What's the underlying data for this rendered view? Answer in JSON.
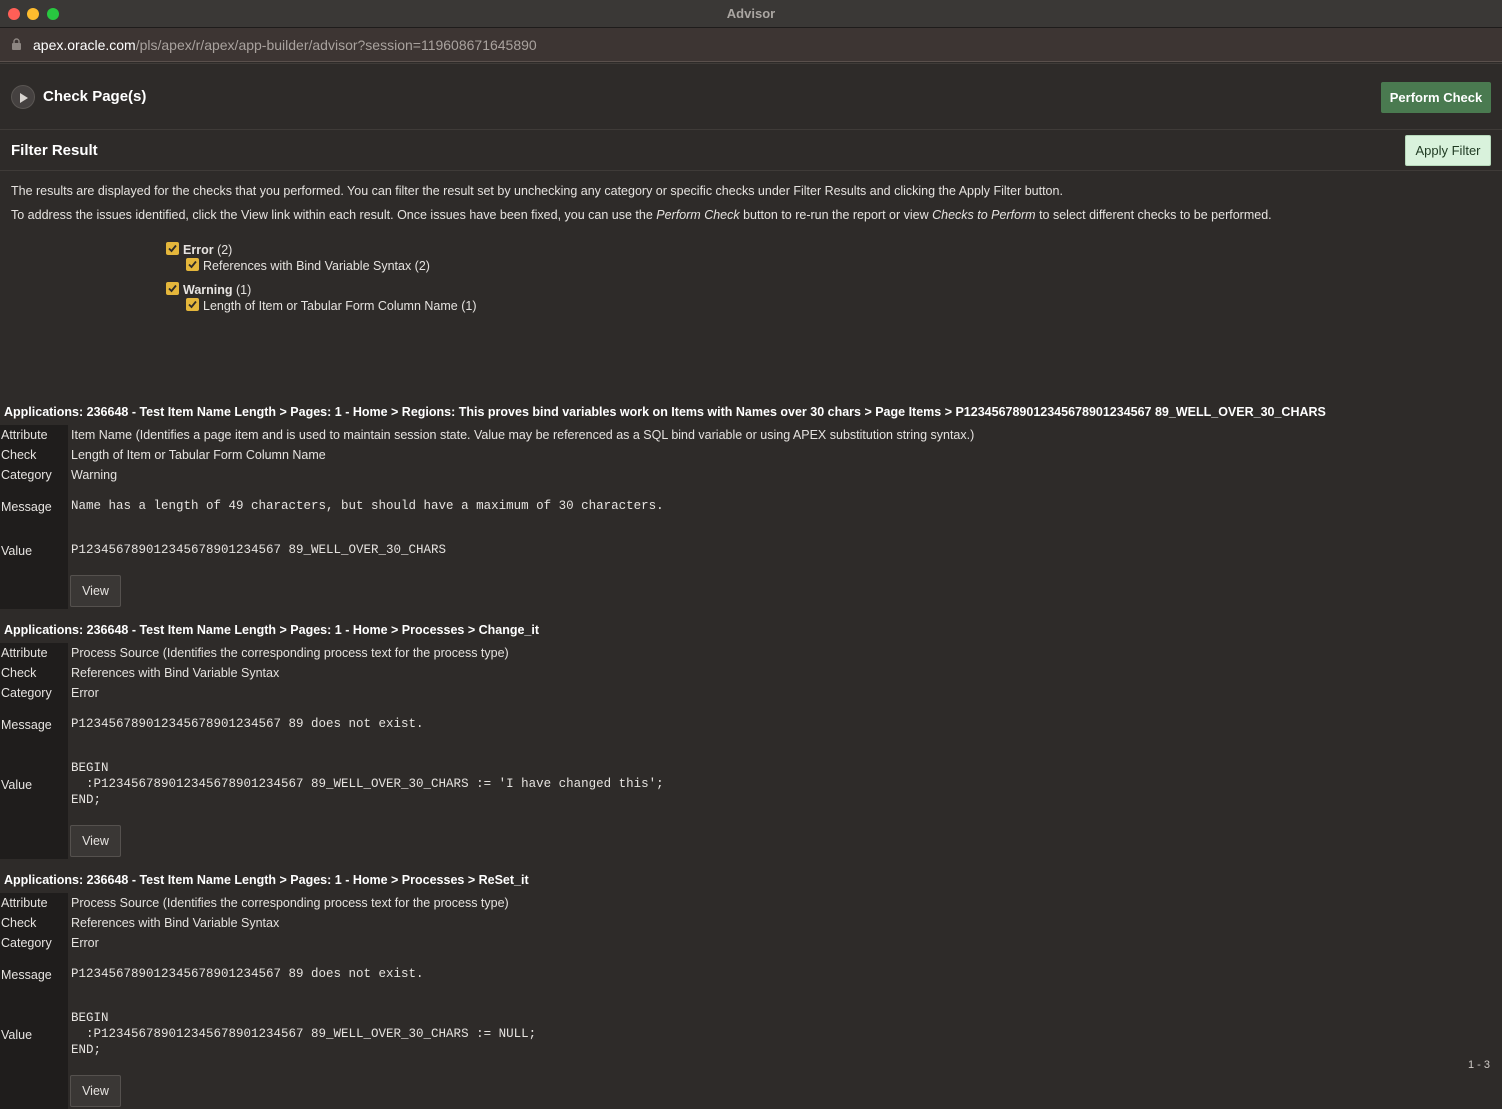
{
  "window": {
    "title": "Advisor"
  },
  "browser": {
    "url_host": "apex.oracle.com",
    "url_path": "/pls/apex/r/apex/app-builder/advisor?session=119608671645890"
  },
  "check_pages": {
    "label": "Check Page(s)",
    "perform_button": "Perform Check"
  },
  "filter": {
    "label": "Filter Result",
    "apply_button": "Apply Filter",
    "info_line1": "The results are displayed for the checks that you performed. You can filter the result set by unchecking any category or specific checks under Filter Results and clicking the Apply Filter button.",
    "info_line2_a": "To address the issues identified, click the View link within each result. Once issues have been fixed, you can use the ",
    "info_line2_em1": "Perform Check",
    "info_line2_b": " button to re-run the report or view ",
    "info_line2_em2": "Checks to Perform",
    "info_line2_c": " to select different checks to be performed.",
    "categories": [
      {
        "name": "Error",
        "count": "(2)",
        "checked": true,
        "checks": [
          {
            "label": "References with Bind Variable Syntax (2)",
            "checked": true
          }
        ]
      },
      {
        "name": "Warning",
        "count": "(1)",
        "checked": true,
        "checks": [
          {
            "label": "Length of Item or Tabular Form Column Name (1)",
            "checked": true
          }
        ]
      }
    ]
  },
  "labels": {
    "attribute": "Attribute",
    "check": "Check",
    "category": "Category",
    "message": "Message",
    "value": "Value",
    "view": "View"
  },
  "results": [
    {
      "crumb": "Applications: 236648 - Test Item Name Length > Pages: 1 - Home > Regions: This proves bind variables work on Items with Names over 30 chars > Page Items > P123456789012345678901234567 89_WELL_OVER_30_CHARS",
      "attribute": "Item Name (Identifies a page item and is used to maintain session state. Value may be referenced as a SQL bind variable or using APEX substitution string syntax.)",
      "check": "Length of Item or Tabular Form Column Name",
      "category": "Warning",
      "message": "Name has a length of 49 characters, but should have a maximum of 30 characters.",
      "value": "P123456789012345678901234567 89_WELL_OVER_30_CHARS"
    },
    {
      "crumb": "Applications: 236648 - Test Item Name Length > Pages: 1 - Home > Processes > Change_it",
      "attribute": "Process Source (Identifies the corresponding process text for the process type)",
      "check": "References with Bind Variable Syntax",
      "category": "Error",
      "message": "P123456789012345678901234567 89 does not exist.",
      "value": "BEGIN\n  :P123456789012345678901234567 89_WELL_OVER_30_CHARS := 'I have changed this';\nEND;"
    },
    {
      "crumb": "Applications: 236648 - Test Item Name Length > Pages: 1 - Home > Processes > ReSet_it",
      "attribute": "Process Source (Identifies the corresponding process text for the process type)",
      "check": "References with Bind Variable Syntax",
      "category": "Error",
      "message": "P123456789012345678901234567 89 does not exist.",
      "value": "BEGIN\n  :P123456789012345678901234567 89_WELL_OVER_30_CHARS := NULL;\nEND;"
    }
  ],
  "pager": "1 - 3"
}
